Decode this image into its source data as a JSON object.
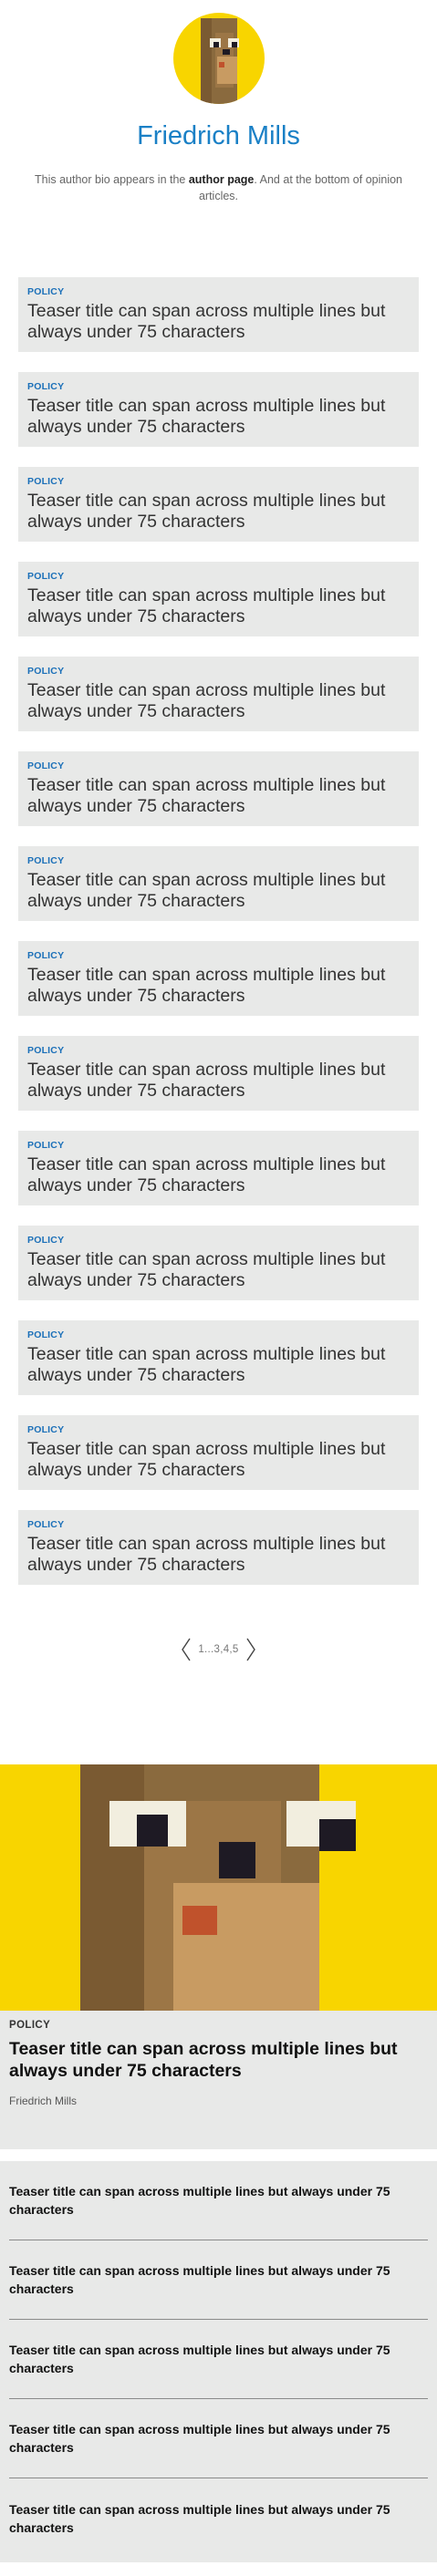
{
  "author": {
    "avatar_icon": "pixel-bear-avatar-icon",
    "name": "Friedrich Mills",
    "bio_before": "This author bio appears in the ",
    "bio_bold": "author page",
    "bio_after": ". And at the bottom of opinion articles."
  },
  "teasers": [
    {
      "category": "POLICY",
      "title": "Teaser title can span across multiple lines but always under 75 characters"
    },
    {
      "category": "POLICY",
      "title": "Teaser title can span across multiple lines but always under 75 characters"
    },
    {
      "category": "POLICY",
      "title": "Teaser title can span across multiple lines but always under 75 characters"
    },
    {
      "category": "POLICY",
      "title": "Teaser title can span across multiple lines but always under 75 characters"
    },
    {
      "category": "POLICY",
      "title": "Teaser title can span across multiple lines but always under 75 characters"
    },
    {
      "category": "POLICY",
      "title": "Teaser title can span across multiple lines but always under 75 characters"
    },
    {
      "category": "POLICY",
      "title": "Teaser title can span across multiple lines but always under 75 characters"
    },
    {
      "category": "POLICY",
      "title": "Teaser title can span across multiple lines but always under 75 characters"
    },
    {
      "category": "POLICY",
      "title": "Teaser title can span across multiple lines but always under 75 characters"
    },
    {
      "category": "POLICY",
      "title": "Teaser title can span across multiple lines but always under 75 characters"
    },
    {
      "category": "POLICY",
      "title": "Teaser title can span across multiple lines but always under 75 characters"
    },
    {
      "category": "POLICY",
      "title": "Teaser title can span across multiple lines but always under 75 characters"
    },
    {
      "category": "POLICY",
      "title": "Teaser title can span across multiple lines but always under 75 characters"
    },
    {
      "category": "POLICY",
      "title": "Teaser title can span across multiple lines but always under 75 characters"
    }
  ],
  "pagination": {
    "pages": "1...3,4,5",
    "prev_icon": "chevron-left-icon",
    "next_icon": "chevron-right-icon"
  },
  "featured": {
    "image_icon": "pixel-bear-image",
    "category": "POLICY",
    "title": "Teaser title can span across multiple lines but always under 75 characters",
    "author": "Friedrich Mills"
  },
  "bottom_list": [
    {
      "title": "Teaser title can span across multiple lines but always under 75 characters"
    },
    {
      "title": "Teaser title can span across multiple lines but always under 75 characters"
    },
    {
      "title": "Teaser title can span across multiple lines but always under 75 characters"
    },
    {
      "title": "Teaser title can span across multiple lines but always under 75 characters"
    },
    {
      "title": "Teaser title can span across multiple lines but always under 75 characters"
    }
  ],
  "colors": {
    "accent_blue": "#1a80c6",
    "category_blue": "#1a6fb8",
    "avatar_yellow": "#f8d500",
    "card_gray": "#e8e9e8"
  }
}
